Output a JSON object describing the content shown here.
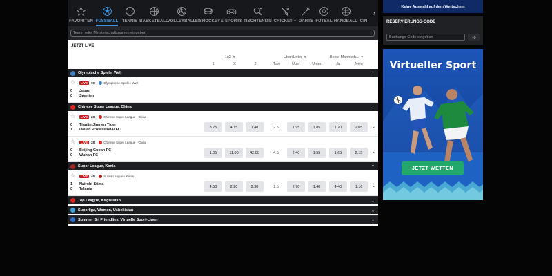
{
  "sports": [
    {
      "label": "FAVORITEN",
      "icon": "star-icon"
    },
    {
      "label": "FUSSBALL",
      "icon": "soccer-ball-icon",
      "active": true
    },
    {
      "label": "TENNIS",
      "icon": "tennis-ball-icon"
    },
    {
      "label": "BASKETBALL",
      "icon": "basketball-icon"
    },
    {
      "label": "VOLLEYBALL",
      "icon": "volleyball-icon"
    },
    {
      "label": "EISHOCKEY",
      "icon": "ice-hockey-puck-icon"
    },
    {
      "label": "E-SPORTS",
      "icon": "gamepad-icon"
    },
    {
      "label": "TISCHTENNIS",
      "icon": "table-tennis-icon"
    },
    {
      "label": "CRICKET +",
      "icon": "cricket-bat-icon"
    },
    {
      "label": "DARTS",
      "icon": "dart-icon"
    },
    {
      "label": "FUTSAL",
      "icon": "futsal-ball-icon"
    },
    {
      "label": "HANDBALL",
      "icon": "handball-icon"
    },
    {
      "label": "CIN",
      "icon": "partial-icon"
    }
  ],
  "search": {
    "placeholder": "Team- oder Meisterschaftsnamen eingeben"
  },
  "live": {
    "title": "JETZT LIVE",
    "groups": {
      "g1": "1x2",
      "g2": "Über/Unter",
      "g3": "Beide Mannsch..."
    },
    "columns": [
      "1",
      "X",
      "2",
      "Tore",
      "Über",
      "Unter",
      "Ja",
      "Nein"
    ]
  },
  "leagues": [
    {
      "name": "Olympische Spiele, Welt",
      "flag": "#3b82c4",
      "toggle": "⌃"
    },
    {
      "name": "Chinese Super League, China",
      "flag": "#d62b1e",
      "toggle": "⌃"
    },
    {
      "name": "Super League, Kenia",
      "flag": "#a8241f",
      "toggle": "⌃"
    },
    {
      "name": "Top League, Kirgisistan",
      "flag": "#d8261c",
      "toggle": "⌄"
    },
    {
      "name": "Superliga, Women, Usbekistan",
      "flag": "#3aa0d8",
      "toggle": "⌄"
    },
    {
      "name": "Summer Srl Friendlies, Virtuelle Sport-Ligen",
      "flag": "#2f6fd0",
      "toggle": "⌄"
    }
  ],
  "matches": [
    {
      "live": "LIVE",
      "minute": "90'",
      "comp": "Olympische Spiele",
      "region": "Welt",
      "dot": "#3b82c4",
      "home": {
        "score": "0",
        "name": "Japan"
      },
      "away": {
        "score": "0",
        "name": "Spanien"
      },
      "odds": {
        "one": "",
        "x": "",
        "two": "",
        "tore": "",
        "over": "",
        "under": "",
        "ja": "",
        "nein": ""
      }
    },
    {
      "live": "LIVE",
      "minute": "28'",
      "comp": "Chinese Super League",
      "region": "China",
      "dot": "#d62b1e",
      "home": {
        "score": "0",
        "name": "Tianjin Jinmen Tiger"
      },
      "away": {
        "score": "1",
        "name": "Dalian Professional FC"
      },
      "odds": {
        "one": "8.75",
        "x": "4.15",
        "two": "1.40",
        "tore": "2.5",
        "over": "1.95",
        "under": "1.85",
        "ja": "1.70",
        "nein": "2.05"
      }
    },
    {
      "live": "LIVE",
      "minute": "28'",
      "comp": "Chinese Super League",
      "region": "China",
      "dot": "#d62b1e",
      "home": {
        "score": "0",
        "name": "Beijing Guoan FC"
      },
      "away": {
        "score": "0",
        "name": "Wuhan FC"
      },
      "odds": {
        "one": "1.05",
        "x": "11.00",
        "two": "42.00",
        "tore": "4.5",
        "over": "2.40",
        "under": "1.55",
        "ja": "1.65",
        "nein": "2.15"
      }
    },
    {
      "live": "LIVE",
      "minute": "45'",
      "comp": "Super League",
      "region": "Kenia",
      "dot": "#a8241f",
      "home": {
        "score": "1",
        "name": "Nairobi Stima"
      },
      "away": {
        "score": "0",
        "name": "Talanta"
      },
      "odds": {
        "one": "4.50",
        "x": "2.20",
        "two": "2.30",
        "tore": "1.5",
        "over": "2.70",
        "under": "1.40",
        "ja": "4.40",
        "nein": "1.16"
      }
    }
  ],
  "sidebar": {
    "bet_strip": "Keine Auswahl auf dem Wettschein",
    "res_title": "RESERVIERUNGS-CODE",
    "res_placeholder": "Buchungs-Code eingeben",
    "banner_title": "Virtueller Sport",
    "banner_cta": "JETZT WETTEN"
  },
  "colors": {
    "accent": "#3a94e5",
    "live": "#d71a1a",
    "cta": "#23a86c",
    "banner": "#1a4ea6"
  }
}
